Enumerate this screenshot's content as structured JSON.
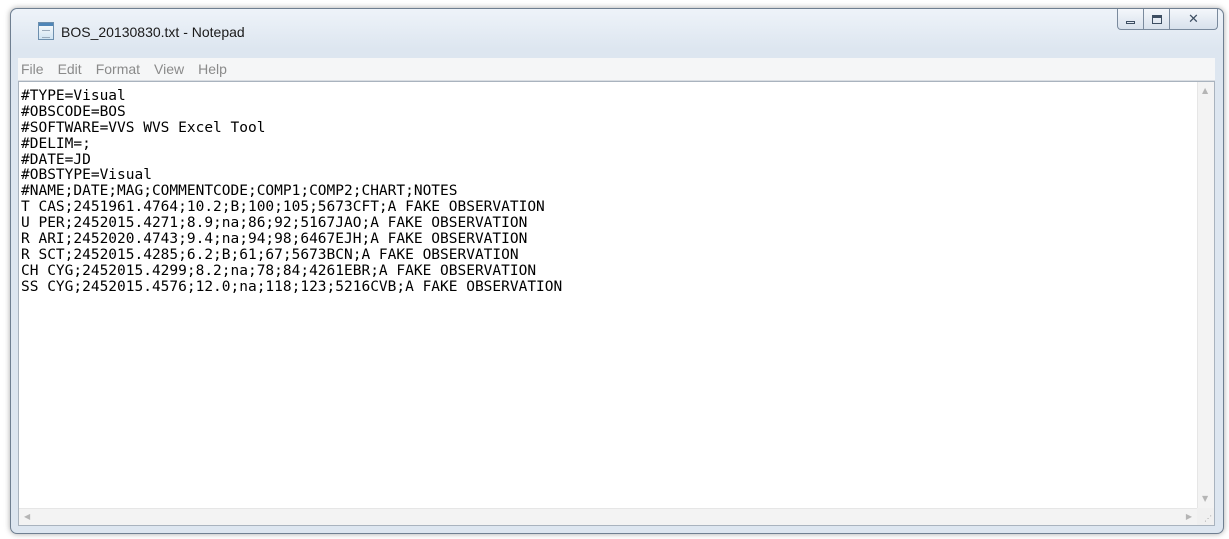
{
  "window": {
    "title": "BOS_20130830.txt - Notepad"
  },
  "menu": [
    "File",
    "Edit",
    "Format",
    "View",
    "Help"
  ],
  "content": {
    "lines": [
      "#TYPE=Visual",
      "#OBSCODE=BOS",
      "#SOFTWARE=VVS WVS Excel Tool",
      "#DELIM=;",
      "#DATE=JD",
      "#OBSTYPE=Visual",
      "#NAME;DATE;MAG;COMMENTCODE;COMP1;COMP2;CHART;NOTES",
      "T CAS;2451961.4764;10.2;B;100;105;5673CFT;A FAKE OBSERVATION",
      "U PER;2452015.4271;8.9;na;86;92;5167JAO;A FAKE OBSERVATION",
      "R ARI;2452020.4743;9.4;na;94;98;6467EJH;A FAKE OBSERVATION",
      "R SCT;2452015.4285;6.2;B;61;67;5673BCN;A FAKE OBSERVATION",
      "CH CYG;2452015.4299;8.2;na;78;84;4261EBR;A FAKE OBSERVATION",
      "SS CYG;2452015.4576;12.0;na;118;123;5216CVB;A FAKE OBSERVATION"
    ]
  },
  "icons": {
    "app": "notepad-icon",
    "minimize": "minimize-icon",
    "maximize": "maximize-icon",
    "close": "close-icon",
    "close_glyph": "☒"
  }
}
